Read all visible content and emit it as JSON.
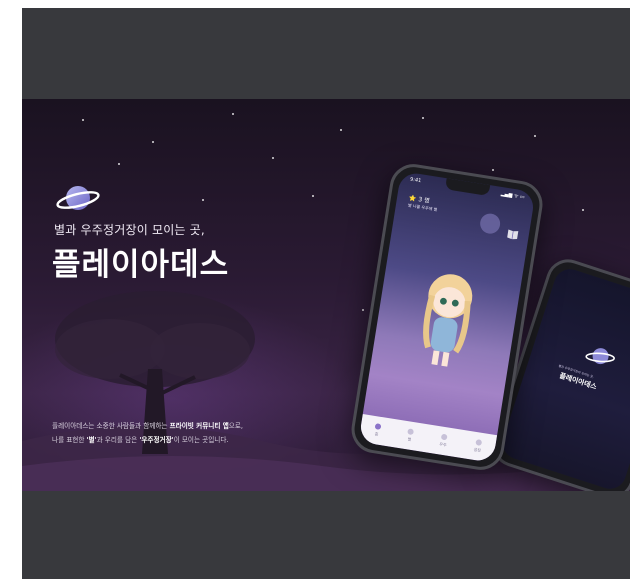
{
  "banner": {
    "tagline": "별과 우주정거장이 모이는 곳,",
    "title": "플레이아데스",
    "desc_line1_a": "플레이아데스는 소중한 사람들과 함께하는 ",
    "desc_line1_b": "프라이빗 커뮤니티 앱",
    "desc_line1_c": "으로,",
    "desc_line2_a": "나를 표현한 ",
    "desc_line2_b": "'별'",
    "desc_line2_c": "과 우리를 담은 ",
    "desc_line2_d": "'우주정거장'",
    "desc_line2_e": "이 모이는 곳입니다."
  },
  "phone1": {
    "time": "9:41",
    "status": "▂▄▆ ᯤ ▭",
    "count": "⭐ 3 명",
    "sub": "별 나를 우주에 별",
    "nav": [
      {
        "label": "홈"
      },
      {
        "label": "별"
      },
      {
        "label": "우주"
      },
      {
        "label": "설정"
      }
    ]
  },
  "phone2": {
    "sub": "별과 우주정거장이 모이는 곳,",
    "title": "플레이아데스"
  },
  "colors": {
    "accent": "#8b73c9",
    "frame": "#38393d"
  }
}
